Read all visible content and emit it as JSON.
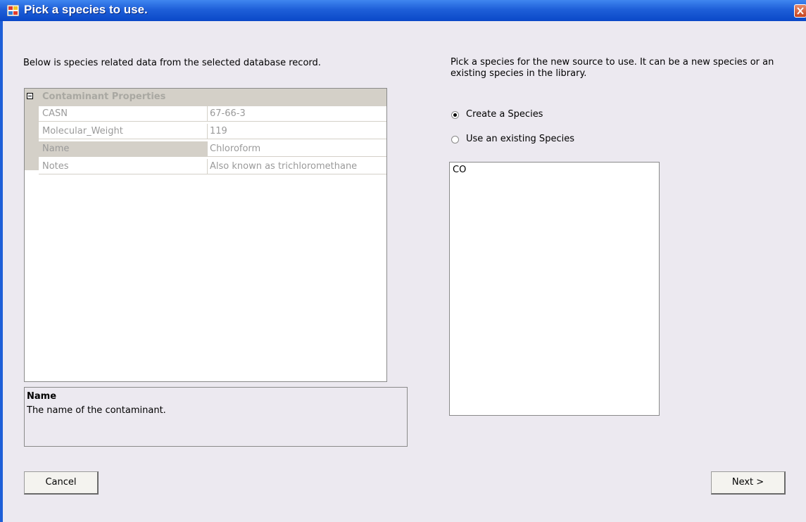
{
  "window": {
    "title": "Pick a species to use.",
    "close_icon": "close-x-icon",
    "app_icon": "window-app-icon"
  },
  "left_panel": {
    "description": "Below is species related data from the selected database record.",
    "property_grid": {
      "category": "Contaminant Properties",
      "rows": [
        {
          "name": "CASN",
          "value": "67-66-3",
          "selected": false
        },
        {
          "name": "Molecular_Weight",
          "value": "119",
          "selected": false
        },
        {
          "name": "Name",
          "value": "Chloroform",
          "selected": true
        },
        {
          "name": "Notes",
          "value": "Also known as trichloromethane",
          "selected": false
        }
      ]
    },
    "help": {
      "title": "Name",
      "description": "The name of the contaminant."
    }
  },
  "right_panel": {
    "description": "Pick a species for the new source to use.  It can be a new species or an existing species in the library.",
    "options": [
      {
        "label": "Create a Species",
        "checked": true
      },
      {
        "label": "Use an existing Species",
        "checked": false
      }
    ],
    "species_list": [
      "CO"
    ]
  },
  "buttons": {
    "cancel": "Cancel",
    "next": "Next >"
  },
  "colors": {
    "titlebar": "#1e5fd8",
    "background": "#ece9f0",
    "grid_category": "#d4d0c8"
  }
}
